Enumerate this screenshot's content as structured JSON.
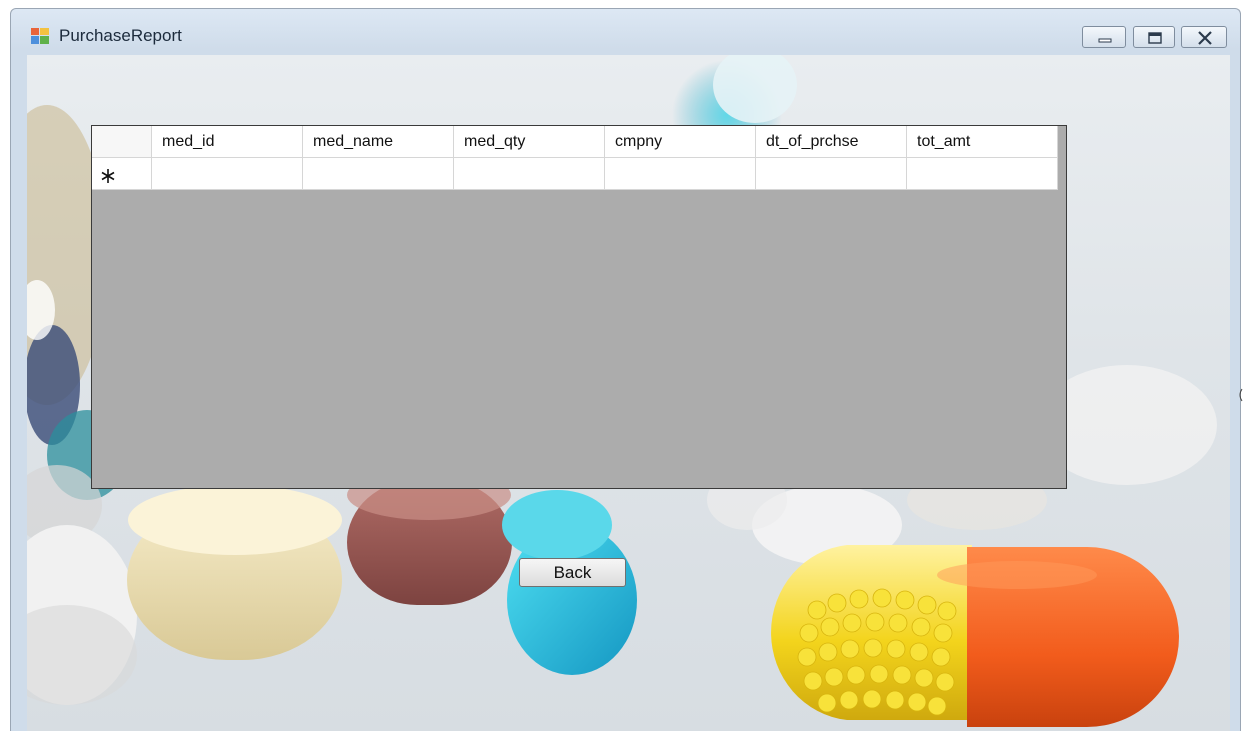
{
  "window": {
    "title": "PurchaseReport",
    "controls": [
      "minimize",
      "maximize",
      "close"
    ]
  },
  "grid": {
    "columns": [
      "med_id",
      "med_name",
      "med_qty",
      "cmpny",
      "dt_of_prchse",
      "tot_amt"
    ],
    "rows": [],
    "new_row_marker": "*"
  },
  "buttons": {
    "back": "Back"
  },
  "colors": {
    "grid_background": "#acacac",
    "title_bar": "#dde8f4",
    "capsule_yellow": "#f2d21c",
    "capsule_orange": "#f26322"
  }
}
